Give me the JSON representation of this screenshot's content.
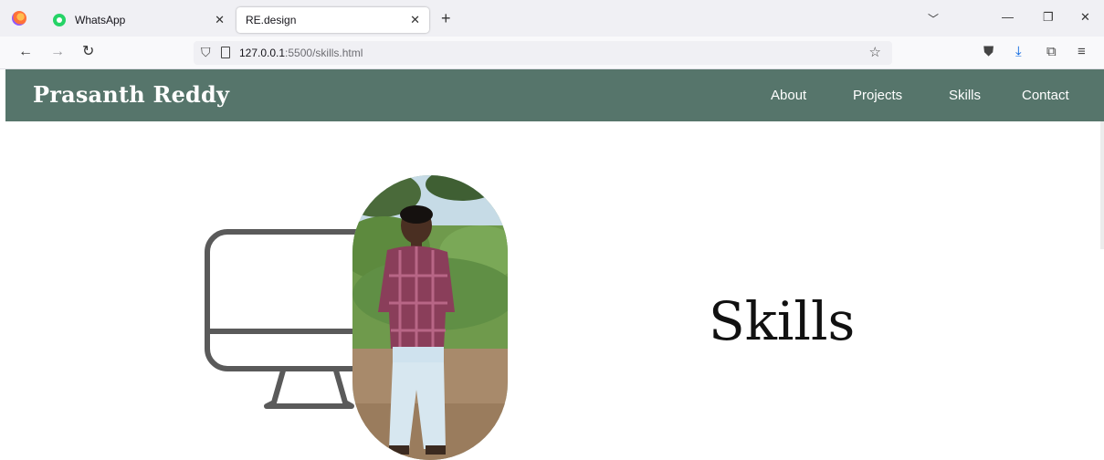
{
  "browser": {
    "tabs": [
      {
        "label": "WhatsApp",
        "icon": "whatsapp-icon"
      },
      {
        "label": "RE.design",
        "active": true
      }
    ],
    "url": {
      "host": "127.0.0.1",
      "rest": ":5500/skills.html"
    },
    "accent": "#0060df"
  },
  "site": {
    "brand": "Prasanth Reddy",
    "nav": [
      "About",
      "Projects",
      "Skills",
      "Contact"
    ],
    "header_color": "#56756b"
  },
  "hero": {
    "title": "Skills",
    "illustration": "monitor-icon"
  }
}
